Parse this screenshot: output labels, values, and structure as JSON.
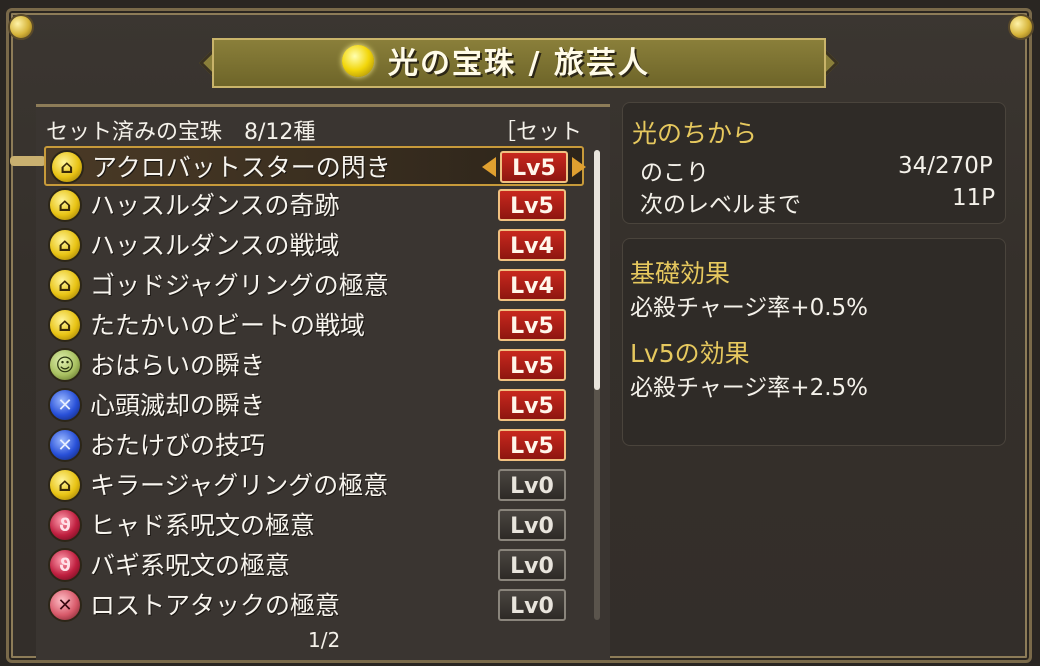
{
  "title": "光の宝珠 / 旅芸人",
  "list": {
    "header": "セット済みの宝珠　8/12種",
    "order": "［セット順］",
    "page": "1/2",
    "items": [
      {
        "name": "アクロバットスターの閃き",
        "level": "Lv5",
        "orb": "yellow",
        "active": true,
        "selected": true
      },
      {
        "name": "ハッスルダンスの奇跡",
        "level": "Lv5",
        "orb": "yellow",
        "active": true
      },
      {
        "name": "ハッスルダンスの戦域",
        "level": "Lv4",
        "orb": "yellow",
        "active": true
      },
      {
        "name": "ゴッドジャグリングの極意",
        "level": "Lv4",
        "orb": "yellow",
        "active": true
      },
      {
        "name": "たたかいのビートの戦域",
        "level": "Lv5",
        "orb": "yellow",
        "active": true
      },
      {
        "name": "おはらいの瞬き",
        "level": "Lv5",
        "orb": "green",
        "active": true
      },
      {
        "name": "心頭滅却の瞬き",
        "level": "Lv5",
        "orb": "blue",
        "active": true
      },
      {
        "name": "おたけびの技巧",
        "level": "Lv5",
        "orb": "blue",
        "active": true
      },
      {
        "name": "キラージャグリングの極意",
        "level": "Lv0",
        "orb": "yellow",
        "active": false
      },
      {
        "name": "ヒャド系呪文の極意",
        "level": "Lv0",
        "orb": "red",
        "active": false
      },
      {
        "name": "バギ系呪文の極意",
        "level": "Lv0",
        "orb": "red",
        "active": false
      },
      {
        "name": "ロストアタックの極意",
        "level": "Lv0",
        "orb": "pink",
        "active": false
      }
    ]
  },
  "power": {
    "title": "光のちから",
    "remaining_label": "のこり",
    "remaining_value": "34/270P",
    "next_label": "次のレベルまで",
    "next_value": "11P"
  },
  "effects": {
    "base_title": "基礎効果",
    "base_text": "必殺チャージ率+0.5%",
    "lv_title": "Lv5の効果",
    "lv_text": "必殺チャージ率+2.5%"
  },
  "colors": {
    "level_active": "#c8281e",
    "level_inactive": "#4a4540",
    "accent_gold": "#e6c85e"
  }
}
